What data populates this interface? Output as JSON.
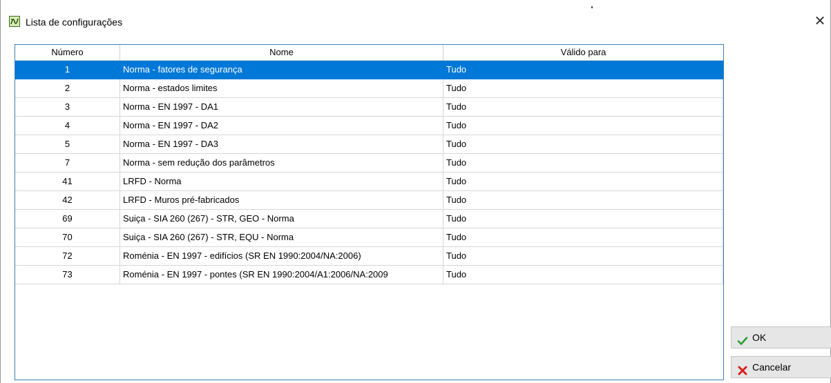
{
  "window": {
    "title": "Lista de configurações",
    "close_glyph": "✕",
    "app_icon": "chart-app-icon"
  },
  "table": {
    "columns": [
      "Número",
      "Nome",
      "Válido para"
    ],
    "selected_row": 0,
    "rows": [
      {
        "num": "1",
        "name": "Norma - fatores de segurança",
        "valid": "Tudo"
      },
      {
        "num": "2",
        "name": "Norma - estados limites",
        "valid": "Tudo"
      },
      {
        "num": "3",
        "name": "Norma - EN 1997 - DA1",
        "valid": "Tudo"
      },
      {
        "num": "4",
        "name": "Norma - EN 1997 - DA2",
        "valid": "Tudo"
      },
      {
        "num": "5",
        "name": "Norma - EN 1997 - DA3",
        "valid": "Tudo"
      },
      {
        "num": "7",
        "name": "Norma - sem redução dos parâmetros",
        "valid": "Tudo"
      },
      {
        "num": "41",
        "name": "LRFD - Norma",
        "valid": "Tudo"
      },
      {
        "num": "42",
        "name": "LRFD - Muros pré-fabricados",
        "valid": "Tudo"
      },
      {
        "num": "69",
        "name": "Suiça - SIA 260 (267) - STR, GEO - Norma",
        "valid": "Tudo"
      },
      {
        "num": "70",
        "name": "Suiça - SIA 260 (267) - STR, EQU - Norma",
        "valid": "Tudo"
      },
      {
        "num": "72",
        "name": "Roménia - EN 1997 - edifícios (SR EN 1990:2004/NA:2006)",
        "valid": "Tudo"
      },
      {
        "num": "73",
        "name": "Roménia - EN 1997 - pontes (SR EN 1990:2004/A1:2006/NA:2009",
        "valid": "Tudo"
      }
    ]
  },
  "buttons": {
    "ok_label": "OK",
    "ok_icon": "checkmark-icon",
    "cancel_label": "Cancelar",
    "cancel_icon": "cross-icon"
  },
  "colors": {
    "selection": "#0078d7",
    "grid_border": "#3c7fb1",
    "ok_icon": "#2e9e2e",
    "cancel_icon": "#d62020"
  }
}
